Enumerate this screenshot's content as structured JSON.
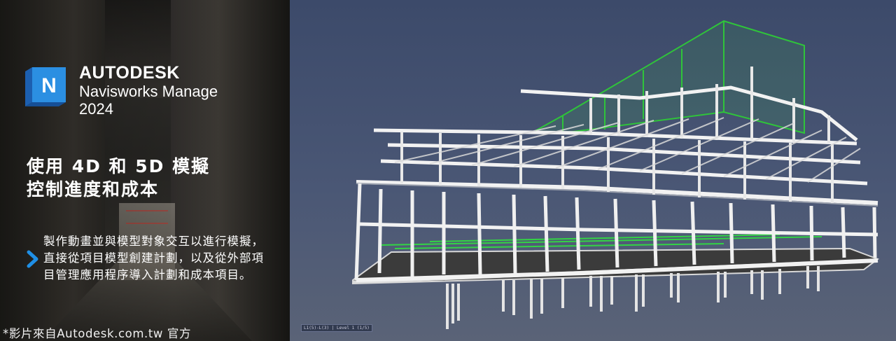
{
  "brand": {
    "company": "AUTODESK",
    "product": "Navisworks Manage",
    "year": "2024",
    "icon_letter": "N"
  },
  "headline": {
    "line1": "使用 4D 和 5D 模擬",
    "line2": "控制進度和成本"
  },
  "description": {
    "line1": "製作動畫並與模型對象交互以進行模擬，",
    "line2": "直接從項目模型創建計劃，以及從外部項",
    "line3": "目管理應用程序導入計劃和成本項目。"
  },
  "caption": "*影片來自Autodesk.com.tw 官方",
  "viewport_status": "L1(5)-L(3) | Level 1 (1/5)",
  "colors": {
    "accent": "#1f8fe6",
    "icon_light": "#2b8fe2",
    "icon_dark": "#1c5fb0",
    "selection_green": "#2fc43a",
    "structure": "#f2f2f2",
    "viewport_bg": "#45537a"
  },
  "icons": {
    "app_logo": "navisworks-logo-icon",
    "bullet": "chevron-right-icon"
  }
}
